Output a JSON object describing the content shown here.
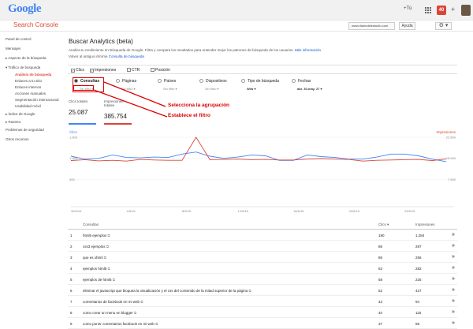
{
  "header": {
    "logo": "Google",
    "plus_link": "+Tú",
    "notif_count": "40",
    "app_name": "Search Console",
    "site": "www.diariodelestudio.com",
    "help": "Ayuda",
    "settings_caret": "⚙ ▾"
  },
  "sidebar": {
    "items": [
      {
        "label": "Panel de control",
        "level": 0,
        "active": false
      },
      {
        "label": "Mensajes",
        "level": 0,
        "active": false
      },
      {
        "label": "▸ Aspecto de la búsqueda",
        "level": 0,
        "active": false
      },
      {
        "label": "▾ Tráfico de búsqueda",
        "level": 0,
        "active": false
      },
      {
        "label": "Análisis de búsqueda",
        "level": 1,
        "active": true
      },
      {
        "label": "Enlaces a tu sitio",
        "level": 1,
        "active": false
      },
      {
        "label": "Enlaces internos",
        "level": 1,
        "active": false
      },
      {
        "label": "Acciones manuales",
        "level": 1,
        "active": false
      },
      {
        "label": "Segmentación internacional",
        "level": 1,
        "active": false
      },
      {
        "label": "Usabilidad móvil",
        "level": 1,
        "active": false
      },
      {
        "label": "▸ Índice de Google",
        "level": 0,
        "active": false
      },
      {
        "label": "▸ Rastreo",
        "level": 0,
        "active": false
      },
      {
        "label": "Problemas de seguridad",
        "level": 0,
        "active": false
      },
      {
        "label": "Otros recursos",
        "level": 0,
        "active": false
      }
    ]
  },
  "main": {
    "title": "Buscar Analytics (beta)",
    "description": "Analiza tu rendimiento en Búsqueda de Google. Filtra y compara los resultados para entender mejor los patrones de búsqueda de los usuarios.",
    "more_info": "Más información",
    "old_prefix": "Volver al antiguo informe",
    "old_link": "Consulta de búsqueda",
    "metrics": [
      {
        "label": "Clics",
        "checked": true
      },
      {
        "label": "Impresiones",
        "checked": true
      },
      {
        "label": "CTR",
        "checked": false
      },
      {
        "label": "Posición",
        "checked": false
      }
    ],
    "dimensions": [
      {
        "label": "Consultas",
        "sub": "Sin filtro ▾",
        "selected": true
      },
      {
        "label": "Páginas",
        "sub": "Sin filtro ▾",
        "selected": false
      },
      {
        "label": "Países",
        "sub": "Sin filtro ▾",
        "selected": false
      },
      {
        "label": "Dispositivos",
        "sub": "Sin filtro ▾",
        "selected": false
      },
      {
        "label": "Tipo de búsqueda",
        "sub": "Web ▾",
        "selected": false
      },
      {
        "label": "Fechas",
        "sub": "abr. 30-may. 27 ▾",
        "selected": false
      }
    ],
    "annotations": [
      "Selecciona la agrupación",
      "Establece el filtro"
    ],
    "stats": [
      {
        "label": "Clics totales",
        "value": "25.087",
        "color": "#4285f4"
      },
      {
        "label": "Impresiones totales",
        "value": "385.754",
        "color": "#db4437"
      }
    ],
    "table": {
      "headers": {
        "query": "Consultas",
        "clicks": "Clics ▾",
        "impressions": "Impresiones"
      },
      "rows": [
        {
          "n": "1",
          "q": "html5 ejemplos",
          "c": "180",
          "i": "1.284"
        },
        {
          "n": "2",
          "q": "css3 ejemplos",
          "c": "86",
          "i": "287"
        },
        {
          "n": "3",
          "q": "que es xhtml",
          "c": "86",
          "i": "256"
        },
        {
          "n": "4",
          "q": "ejemplos html5",
          "c": "62",
          "i": "282"
        },
        {
          "n": "5",
          "q": "ejemplos de html5",
          "c": "58",
          "i": "225"
        },
        {
          "n": "6",
          "q": "eliminar el javascript que bloquea la visualización y el css del contenido de la mitad superior de la página",
          "c": "52",
          "i": "427"
        },
        {
          "n": "7",
          "q": "comentarios de facebook en mi web",
          "c": "42",
          "i": "94"
        },
        {
          "n": "8",
          "q": "como crear un menu en blogger",
          "c": "40",
          "i": "115"
        },
        {
          "n": "9",
          "q": "como poner comentarios facebook en mi web",
          "c": "37",
          "i": "58"
        }
      ]
    }
  },
  "chart_data": {
    "type": "line",
    "left_axis_label": "Clics",
    "right_axis_label": "Impresiones",
    "x_ticks": [
      "30/4/15",
      "4/5/15",
      "8/5/15",
      "12/5/15",
      "16/5/15",
      "20/5/15",
      "24/5/15"
    ],
    "left_ticks": [
      "1.500",
      "1.000",
      "500"
    ],
    "right_ticks": [
      "22.500",
      "15.000",
      "7.500"
    ],
    "ylim_left": [
      0,
      1500
    ],
    "ylim_right": [
      0,
      22500
    ],
    "series": [
      {
        "name": "Clics",
        "color": "#4285f4",
        "axis": "left",
        "values": [
          1050,
          980,
          1000,
          1080,
          1020,
          1010,
          1030,
          1020,
          1100,
          1150,
          1050,
          1000,
          1030,
          1080,
          1060,
          950,
          950,
          1080,
          1040,
          1020,
          980,
          980,
          1030,
          1100,
          1100,
          1060,
          980,
          920
        ]
      },
      {
        "name": "Impresiones",
        "color": "#db4437",
        "axis": "right",
        "values": [
          14200,
          14500,
          14100,
          14300,
          14000,
          14600,
          14400,
          14300,
          14300,
          22500,
          14500,
          14600,
          14700,
          14500,
          14600,
          14400,
          14400,
          14700,
          14900,
          14700,
          14600,
          14000,
          14300,
          14400,
          14500,
          14600,
          14200,
          14800
        ]
      }
    ]
  }
}
